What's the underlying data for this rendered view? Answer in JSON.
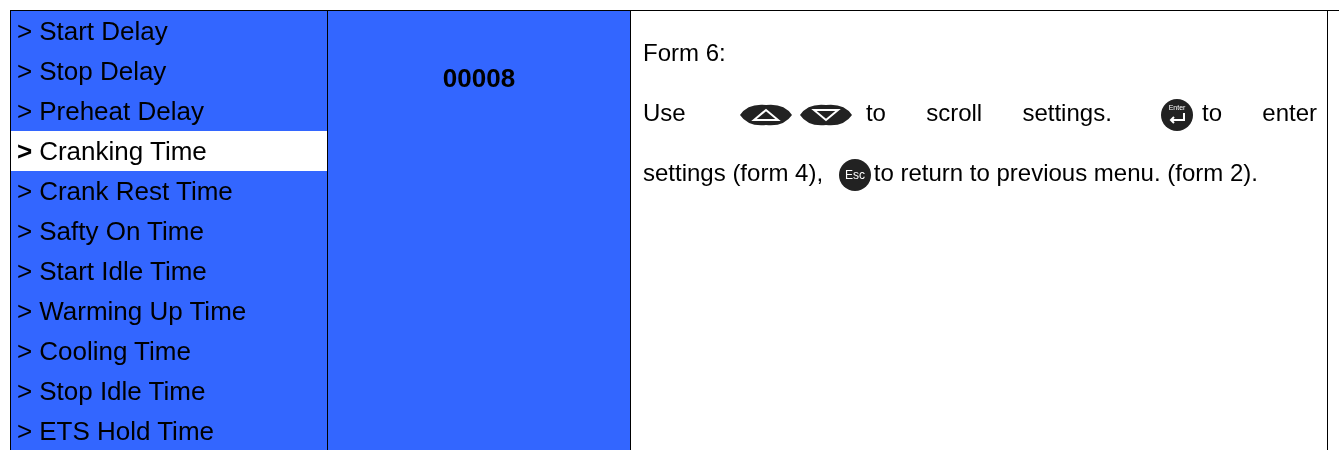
{
  "menu": {
    "items": [
      {
        "marker": ">",
        "label": "Start Delay",
        "selected": false
      },
      {
        "marker": ">",
        "label": "Stop Delay",
        "selected": false
      },
      {
        "marker": ">",
        "label": "Preheat Delay",
        "selected": false
      },
      {
        "marker": ">",
        "label": "Cranking Time",
        "selected": true
      },
      {
        "marker": ">",
        "label": "Crank Rest Time",
        "selected": false
      },
      {
        "marker": ">",
        "label": "Safty On Time",
        "selected": false
      },
      {
        "marker": ">",
        "label": "Start Idle Time",
        "selected": false
      },
      {
        "marker": ">",
        "label": "Warming Up Time",
        "selected": false
      },
      {
        "marker": ">",
        "label": "Cooling Time",
        "selected": false
      },
      {
        "marker": ">",
        "label": "Stop Idle Time",
        "selected": false
      },
      {
        "marker": ">",
        "label": "ETS Hold Time",
        "selected": false
      }
    ]
  },
  "value": "00008",
  "description": {
    "title": "Form 6:",
    "parts": [
      {
        "kind": "text",
        "text": "Use"
      },
      {
        "kind": "up-key"
      },
      {
        "kind": "down-key"
      },
      {
        "kind": "text",
        "text": "to scroll settings."
      },
      {
        "kind": "enter-key",
        "label": "Enter"
      },
      {
        "kind": "text",
        "text": "to enter"
      },
      {
        "kind": "text",
        "text": "settings (form 4),"
      },
      {
        "kind": "esc-key",
        "label": "Esc"
      },
      {
        "kind": "text",
        "text": "to return to previous"
      },
      {
        "kind": "text",
        "text": "menu. (form 2)."
      }
    ]
  }
}
